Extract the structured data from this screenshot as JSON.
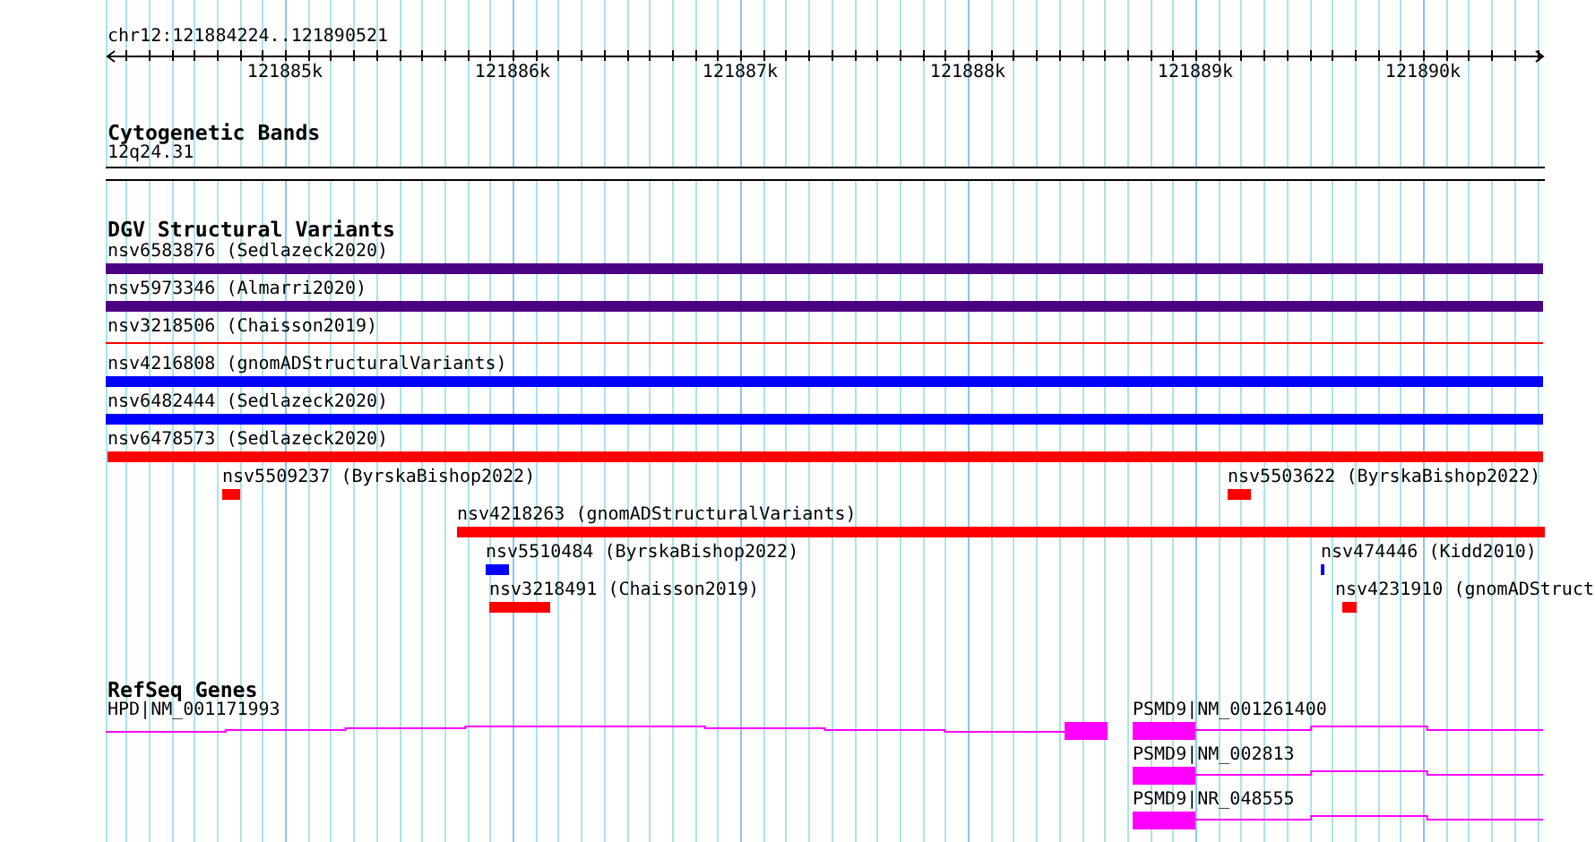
{
  "ruler": {
    "location": "chr12:121884224..121890521",
    "ticks": [
      "121885k",
      "121886k",
      "121887k",
      "121888k",
      "121889k",
      "121890k"
    ]
  },
  "cytogenetic_bands": {
    "title": "Cytogenetic Bands",
    "band": "12q24.31"
  },
  "dgv": {
    "title": "DGV Structural Variants",
    "rows": [
      {
        "features": [
          {
            "label": "nsv6583876 (Sedlazeck2020)",
            "color": "#4b0082",
            "kind": "bar"
          }
        ]
      },
      {
        "features": [
          {
            "label": "nsv5973346 (Almarri2020)",
            "color": "#4b0082",
            "kind": "bar"
          }
        ]
      },
      {
        "features": [
          {
            "label": "nsv3218506 (Chaisson2019)",
            "color": "#ff0000",
            "kind": "line"
          }
        ]
      },
      {
        "features": [
          {
            "label": "nsv4216808 (gnomADStructuralVariants)",
            "color": "#0000ff",
            "kind": "bar"
          }
        ]
      },
      {
        "features": [
          {
            "label": "nsv6482444 (Sedlazeck2020)",
            "color": "#0000ff",
            "kind": "bar"
          }
        ]
      },
      {
        "features": [
          {
            "label": "nsv6478573 (Sedlazeck2020)",
            "color": "#ff0000",
            "kind": "bar"
          }
        ]
      },
      {
        "features": [
          {
            "label": "nsv5509237 (ByrskaBishop2022)",
            "color": "#ff0000",
            "kind": "bar"
          },
          {
            "label": "nsv5503622 (ByrskaBishop2022)",
            "color": "#ff0000",
            "kind": "bar"
          }
        ]
      },
      {
        "features": [
          {
            "label": "nsv4218263 (gnomADStructuralVariants)",
            "color": "#ff0000",
            "kind": "bar"
          }
        ]
      },
      {
        "features": [
          {
            "label": "nsv5510484 (ByrskaBishop2022)",
            "color": "#0000ff",
            "kind": "bar"
          },
          {
            "label": "nsv474446 (Kidd2010)",
            "color": "#0000ff",
            "kind": "bar"
          }
        ]
      },
      {
        "features": [
          {
            "label": "nsv3218491 (Chaisson2019)",
            "color": "#ff0000",
            "kind": "bar"
          },
          {
            "label": "nsv4231910 (gnomADStruct",
            "color": "#ff0000",
            "kind": "bar"
          }
        ]
      }
    ]
  },
  "refseq": {
    "title": "RefSeq Genes",
    "rows": [
      {
        "genes": [
          {
            "label": "HPD|NM_001171993"
          },
          {
            "label": "PSMD9|NM_001261400"
          }
        ]
      },
      {
        "genes": [
          {
            "label": "PSMD9|NM_002813"
          }
        ]
      },
      {
        "genes": [
          {
            "label": "PSMD9|NR_048555"
          }
        ]
      }
    ]
  }
}
